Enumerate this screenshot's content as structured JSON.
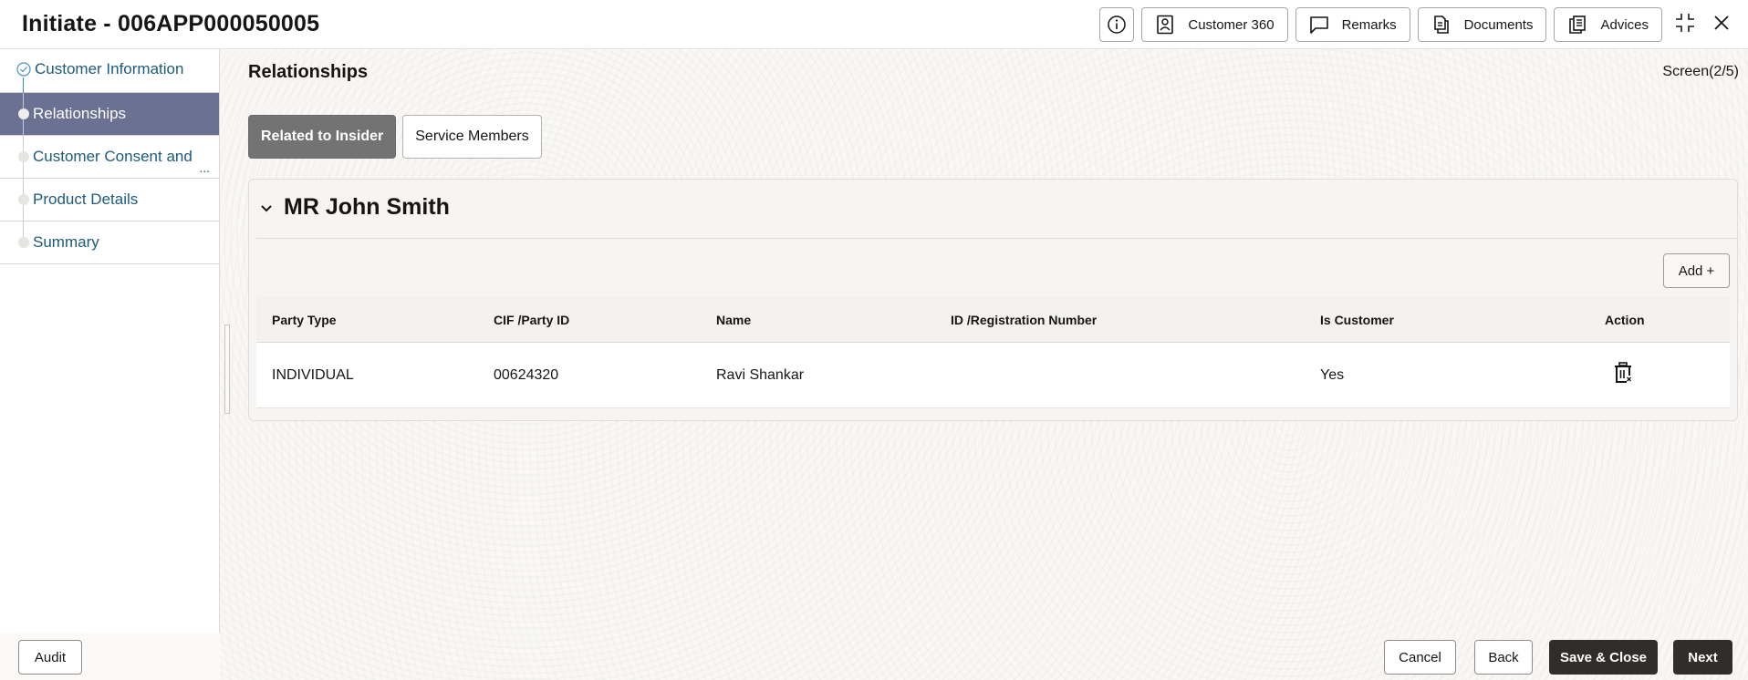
{
  "header": {
    "title": "Initiate - 006APP000050005",
    "actions": [
      {
        "label": "Customer 360",
        "icon": "customer-360-icon"
      },
      {
        "label": "Remarks",
        "icon": "remarks-icon"
      },
      {
        "label": "Documents",
        "icon": "documents-icon"
      },
      {
        "label": "Advices",
        "icon": "advices-icon"
      }
    ]
  },
  "sidebar": {
    "steps": [
      {
        "label": "Customer Information",
        "state": "completed"
      },
      {
        "label": "Relationships",
        "state": "active"
      },
      {
        "label": "Customer Consent and",
        "state": "pending",
        "truncated": "..."
      },
      {
        "label": "Product Details",
        "state": "pending"
      },
      {
        "label": "Summary",
        "state": "pending"
      }
    ]
  },
  "main": {
    "section_title": "Relationships",
    "screen_indicator": "Screen(2/5)",
    "toggles": [
      {
        "label": "Related to Insider",
        "selected": true
      },
      {
        "label": "Service Members",
        "selected": false
      }
    ],
    "card": {
      "name": "MR John Smith",
      "add_label": "Add +",
      "columns": [
        "Party Type",
        "CIF /Party ID",
        "Name",
        "ID /Registration Number",
        "Is Customer",
        "Action"
      ],
      "rows": [
        {
          "party_type": "INDIVIDUAL",
          "cif": "00624320",
          "name": "Ravi Shankar",
          "reg_number": "",
          "is_customer": "Yes",
          "action_icon": "delete-icon"
        }
      ]
    }
  },
  "footer": {
    "audit": "Audit",
    "cancel": "Cancel",
    "back": "Back",
    "save_close": "Save & Close",
    "next": "Next"
  }
}
